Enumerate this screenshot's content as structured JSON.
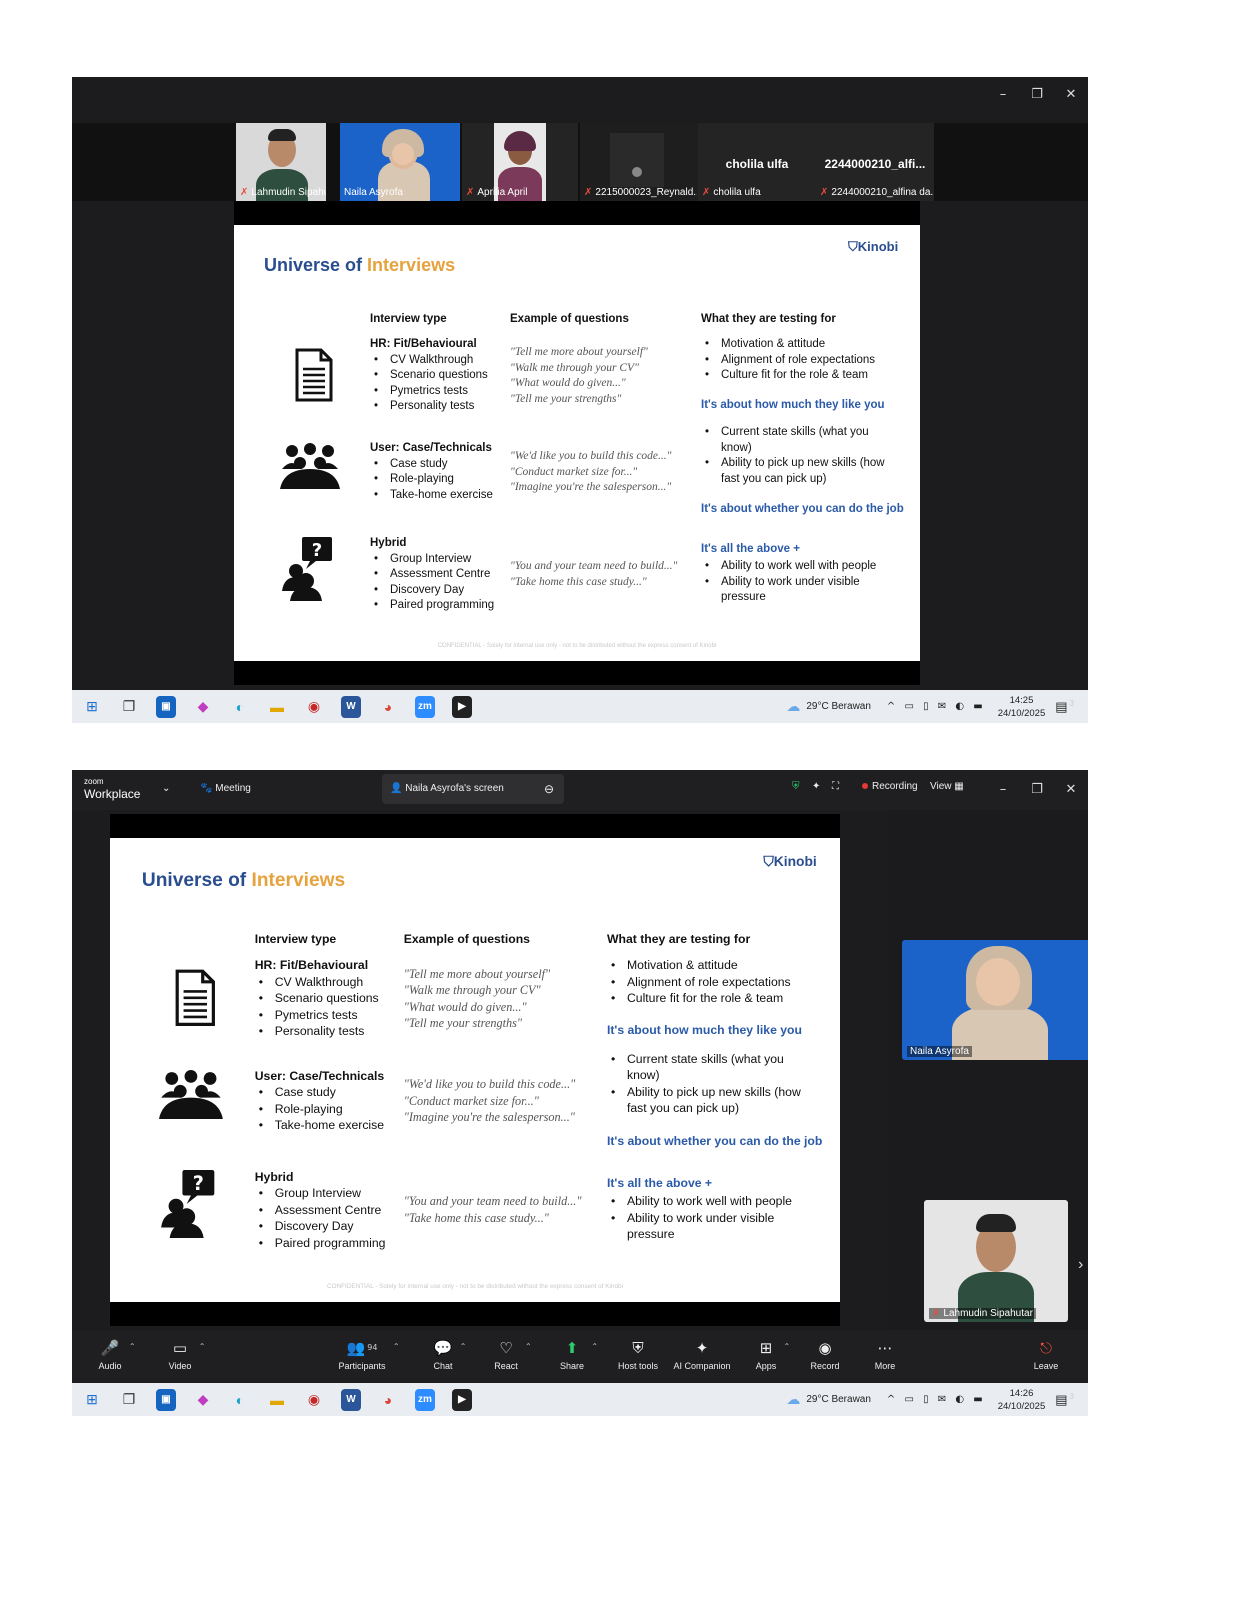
{
  "window_controls": {
    "minimize": "–",
    "restore": "❐",
    "close": "✕"
  },
  "gallery": [
    {
      "name": "Lahmudin Sipahutar",
      "muted": true
    },
    {
      "name": "Naila Asyrofa",
      "muted": false,
      "active": true
    },
    {
      "name": "Aprilia April",
      "muted": true
    },
    {
      "name": "2215000023_Reynald...",
      "muted": true
    },
    {
      "name": "cholila ulfa",
      "display": "cholila ulfa",
      "muted": true
    },
    {
      "name": "2244000210_alfina da...",
      "display": "2244000210_alfi...",
      "muted": true
    }
  ],
  "slide": {
    "title_main": "Universe of ",
    "title_accent": "Interviews",
    "brand": "Kinobi",
    "columns": {
      "type": "Interview type",
      "questions": "Example of questions",
      "testing": "What they are testing for"
    },
    "rows": [
      {
        "icon": "document-icon",
        "heading": "HR: Fit/Behavioural",
        "items": [
          "CV Walkthrough",
          "Scenario questions",
          "Pymetrics tests",
          "Personality tests"
        ],
        "questions": [
          "\"Tell me more about yourself\"",
          "\"Walk me through your CV\"",
          "\"What would do given...\"",
          "\"Tell me your strengths\""
        ]
      },
      {
        "icon": "group-icon",
        "heading": "User: Case/Technicals",
        "items": [
          "Case study",
          "Role-playing",
          "Take-home exercise"
        ],
        "questions": [
          "\"We'd like you to build this code...\"",
          "\"Conduct market size for...\"",
          "\"Imagine you're the salesperson...\""
        ]
      },
      {
        "icon": "people-question-icon",
        "heading": "Hybrid",
        "items": [
          "Group Interview",
          "Assessment Centre",
          "Discovery Day",
          "Paired programming"
        ],
        "questions": [
          "\"You and your team need to build...\"",
          "\"Take home this case study...\""
        ]
      }
    ],
    "testing": {
      "block1": [
        "Motivation & attitude",
        "Alignment of role expectations",
        "Culture fit for the role & team"
      ],
      "headline1": "It's about how much they like you",
      "block2": [
        "Current state skills (what you know)",
        "Ability to pick up new skills (how fast you can pick up)"
      ],
      "headline2": "It's about whether you can do the job",
      "headline3": "It's all the above +",
      "block3": [
        "Ability to work well with people",
        "Ability to work under visible pressure"
      ]
    },
    "confidential": "CONFIDENTIAL - Solely for internal use only - not to be distributed without the express consent of Kinobi"
  },
  "taskbar": {
    "icons": [
      "windows-start",
      "task-view",
      "store",
      "copilot",
      "edge",
      "file-explorer",
      "app-red",
      "word",
      "chrome",
      "zoom",
      "media-player"
    ],
    "weather": "29°C  Berawan",
    "system": "^ ▭ ▯ ✉ ◐ ▬",
    "shot1_time": "14:25",
    "shot2_time": "14:26",
    "date": "24/10/2025",
    "notif": "3"
  },
  "zoom": {
    "logo_small": "zoom",
    "logo_big": "Workplace",
    "meeting": "Meeting",
    "share_title": "Naila Asyrofa's screen",
    "recording": "Recording",
    "view": "View",
    "speaker1": "Naila Asyrofa",
    "speaker2": "Lahmudin Sipahutar",
    "participants_count": "94",
    "controls": {
      "audio": "Audio",
      "video": "Video",
      "participants": "Participants",
      "chat": "Chat",
      "react": "React",
      "share": "Share",
      "host_tools": "Host tools",
      "ai": "AI Companion",
      "apps": "Apps",
      "record": "Record",
      "more": "More",
      "leave": "Leave"
    }
  }
}
